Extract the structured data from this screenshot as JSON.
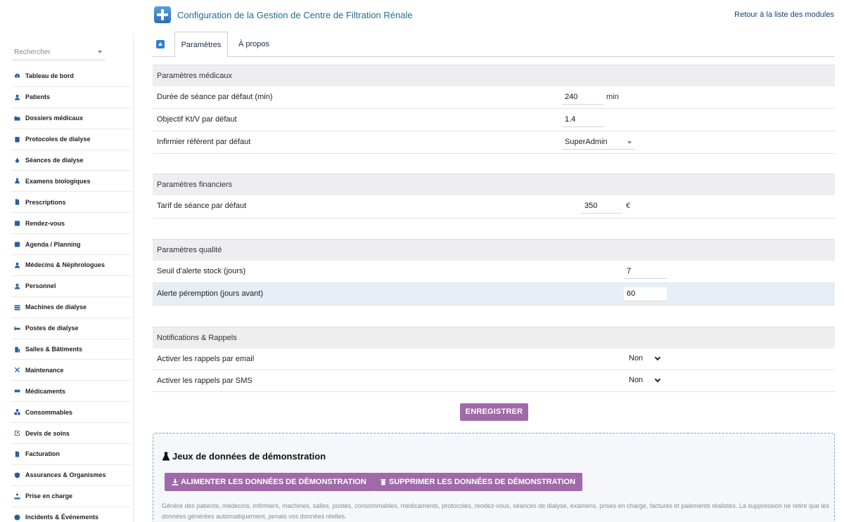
{
  "header": {
    "title": "Configuration de la Gestion de Centre de Filtration Rénale",
    "back_link": "Retour à la liste des modules"
  },
  "sidebar": {
    "search_placeholder": "Rechercher",
    "items": [
      {
        "label": "Tableau de bord",
        "icon": "dashboard-icon"
      },
      {
        "label": "Patients",
        "icon": "user-icon"
      },
      {
        "label": "Dossiers médicaux",
        "icon": "folder-icon"
      },
      {
        "label": "Protocoles de dialyse",
        "icon": "clipboard-icon"
      },
      {
        "label": "Séances de dialyse",
        "icon": "drop-icon"
      },
      {
        "label": "Examens biologiques",
        "icon": "flask-icon"
      },
      {
        "label": "Prescriptions",
        "icon": "file-icon"
      },
      {
        "label": "Rendez-vous",
        "icon": "calendar-check-icon"
      },
      {
        "label": "Agenda / Planning",
        "icon": "calendar-icon"
      },
      {
        "label": "Médecins & Néphrologues",
        "icon": "doctor-icon"
      },
      {
        "label": "Personnel",
        "icon": "staff-icon"
      },
      {
        "label": "Machines de dialyse",
        "icon": "machine-icon"
      },
      {
        "label": "Postes de dialyse",
        "icon": "bed-icon"
      },
      {
        "label": "Salles & Bâtiments",
        "icon": "building-icon"
      },
      {
        "label": "Maintenance",
        "icon": "tools-icon"
      },
      {
        "label": "Médicaments",
        "icon": "pills-icon"
      },
      {
        "label": "Consommables",
        "icon": "boxes-icon"
      },
      {
        "label": "Devis de soins",
        "icon": "edit-icon"
      },
      {
        "label": "Facturation",
        "icon": "invoice-icon"
      },
      {
        "label": "Assurances & Organismes",
        "icon": "shield-icon"
      },
      {
        "label": "Prise en charge",
        "icon": "support-icon"
      },
      {
        "label": "Incidents & Événements",
        "icon": "alert-icon"
      }
    ]
  },
  "tabs": {
    "settings": "Paramètres",
    "about": "À propos"
  },
  "medical": {
    "heading": "Paramètres médicaux",
    "session_duration_label": "Durée de séance par défaut (min)",
    "session_duration_value": "240",
    "session_duration_unit": "min",
    "ktv_label": "Objectif Kt/V par défaut",
    "ktv_value": "1.4",
    "nurse_label": "Infirmier référent par défaut",
    "nurse_value": "SuperAdmin"
  },
  "financial": {
    "heading": "Paramètres financiers",
    "rate_label": "Tarif de séance par défaut",
    "rate_value": "350",
    "rate_unit": "€"
  },
  "quality": {
    "heading": "Paramètres qualité",
    "stock_label": "Seuil d'alerte stock (jours)",
    "stock_value": "7",
    "expiry_label": "Alerte péremption (jours avant)",
    "expiry_value": "60"
  },
  "notifications": {
    "heading": "Notifications & Rappels",
    "email_label": "Activer les rappels par email",
    "email_value": "Non",
    "sms_label": "Activer les rappels par SMS",
    "sms_value": "Non"
  },
  "save_label": "ENREGISTRER",
  "demo": {
    "title": "Jeux de données de démonstration",
    "load_label": "ALIMENTER LES DONNÉES DE DÉMONSTRATION",
    "delete_label": "SUPPRIMER LES DONNÉES DE DÉMONSTRATION",
    "description": "Génère des patients, médecins, infirmiers, machines, salles, postes, consommables, médicaments, protocoles, rendez-vous, séances de dialyse, examens, prises en charge, factures et paiements réalistes. La suppression ne retire que les données générées automatiquement, jamais vos données réelles."
  },
  "colors": {
    "accent": "#a06aa8",
    "title": "#1d6f8f",
    "link": "#1c3f73",
    "icon": "#2a5d9f"
  }
}
